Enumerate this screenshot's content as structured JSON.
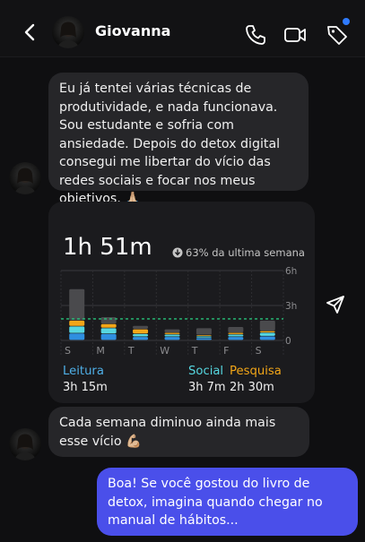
{
  "header": {
    "contact_name": "Giovanna",
    "icons": [
      "chevron-left-icon",
      "phone-icon",
      "video-icon",
      "tag-icon"
    ],
    "accent_dot_color": "#2f7bff"
  },
  "messages": [
    {
      "from": "contact",
      "text": "Eu já tentei várias técnicas de produtividade, e nada funcionava. Sou estudante e sofria com ansiedade. Depois do detox digital consegui me libertar do vício das redes sociais e focar nos meus objetivos. 🙏🏼"
    },
    {
      "from": "contact",
      "text": "Cada semana diminuo ainda mais esse vício 💪🏼"
    },
    {
      "from": "me",
      "text": "Boa! Se você gostou do livro de detox, imagina quando chegar no manual de hábitos..."
    }
  ],
  "screen_time_card": {
    "total": "1h 51m",
    "trend_text": "63% da ultima semana",
    "legend": [
      {
        "label": "Leitura",
        "value": "3h 15m",
        "color": "#4fb0e8"
      },
      {
        "label": "Social",
        "value": "3h 7m",
        "color": "#56d7e0"
      },
      {
        "label": "Pesquisa",
        "value": "2h 30m",
        "color": "#f2a618"
      }
    ],
    "colors": {
      "leitura": "#2f8fe0",
      "social": "#56d7e0",
      "pesquisa": "#f2a618",
      "other": "#4a4a4d",
      "avg_line": "#27c27a"
    }
  },
  "chart_data": {
    "type": "bar",
    "categories": [
      "S",
      "M",
      "T",
      "W",
      "T",
      "F",
      "S"
    ],
    "ylim": [
      0,
      6
    ],
    "y_ticks": [
      "0",
      "3h",
      "6h"
    ],
    "average_hours": 1.85,
    "series": [
      {
        "key": "leitura",
        "values": [
          0.6,
          0.55,
          0.3,
          0.3,
          0.2,
          0.3,
          0.35
        ]
      },
      {
        "key": "social",
        "values": [
          0.6,
          0.5,
          0.25,
          0.2,
          0.15,
          0.2,
          0.3
        ]
      },
      {
        "key": "pesquisa",
        "values": [
          0.5,
          0.35,
          0.4,
          0.15,
          0.1,
          0.15,
          0.15
        ]
      },
      {
        "key": "other",
        "values": [
          2.7,
          0.6,
          0.3,
          0.3,
          0.6,
          0.5,
          0.9
        ]
      }
    ]
  }
}
